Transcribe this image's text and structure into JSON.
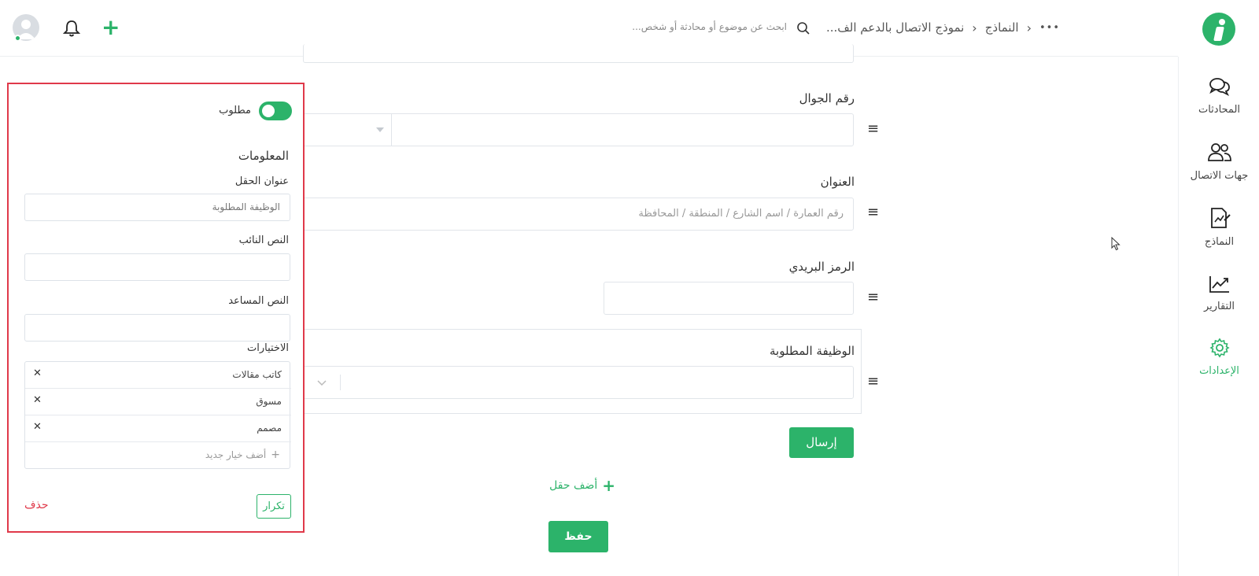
{
  "header": {
    "breadcrumb": {
      "more": "•••",
      "section": "النماذج",
      "current": "نموذج الاتصال بالدعم الف..."
    },
    "search": {
      "placeholder": "ابحث عن موضوع أو محادثة أو شخص..."
    },
    "add_symbol": "+"
  },
  "sidebar": {
    "items": [
      {
        "label": "المحادثات",
        "icon": "chat-bubbles-icon",
        "active": false
      },
      {
        "label": "جهات الاتصال",
        "icon": "contacts-icon",
        "active": false
      },
      {
        "label": "النماذج",
        "icon": "forms-icon",
        "active": false
      },
      {
        "label": "التقارير",
        "icon": "reports-chart-icon",
        "active": false
      },
      {
        "label": "الإعدادات",
        "icon": "gear-icon",
        "active": true
      }
    ]
  },
  "form": {
    "fields": [
      {
        "label": "رقم الجوال"
      },
      {
        "label": "العنوان",
        "placeholder": "رقم العمارة / اسم الشارع / المنطقة / المحافظة"
      },
      {
        "label": "الرمز البريدي"
      },
      {
        "label": "الوظيفة المطلوبة"
      }
    ],
    "submit_label": "إرسال",
    "add_field_label": "أضف حقل",
    "save_label": "حفظ"
  },
  "panel": {
    "required_label": "مطلوب",
    "required_on": true,
    "section_title": "المعلومات",
    "field_title_label": "عنوان الحقل",
    "field_title_value": "الوظيفة المطلوبة",
    "alt_text_label": "النص النائب",
    "help_text_label": "النص المساعد",
    "options_label": "الاختيارات",
    "options": [
      "كاتب مقالات",
      "مسوق",
      "مصمم"
    ],
    "add_option_label": "أضف خيار جديد",
    "duplicate_label": "تكرار",
    "delete_label": "حذف"
  },
  "colors": {
    "accent": "#2cb36a",
    "danger": "#e0394a",
    "highlight_border": "#e0394a"
  }
}
